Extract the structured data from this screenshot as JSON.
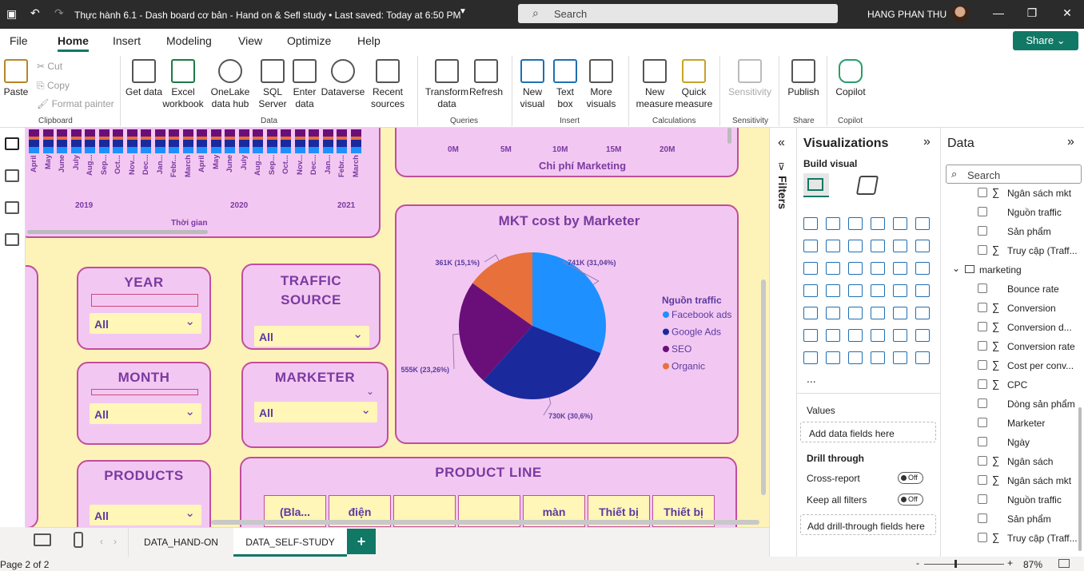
{
  "titlebar": {
    "title": "Thực hành 6.1 - Dash board cơ bản - Hand on & Sefl study • Last saved: Today at 6:50 PM",
    "search_placeholder": "Search",
    "user": "HANG PHAN THU"
  },
  "menu": {
    "file": "File",
    "home": "Home",
    "insert": "Insert",
    "modeling": "Modeling",
    "view": "View",
    "optimize": "Optimize",
    "help": "Help",
    "share": "Share"
  },
  "ribbon": {
    "paste": "Paste",
    "cut": "Cut",
    "copy": "Copy",
    "format_painter": "Format painter",
    "clipboard": "Clipboard",
    "get_data": "Get data",
    "excel": "Excel workbook",
    "onelake": "OneLake data hub",
    "sql": "SQL Server",
    "enter": "Enter data",
    "dataverse": "Dataverse",
    "recent": "Recent sources",
    "data_group": "Data",
    "transform": "Transform data",
    "refresh": "Refresh",
    "queries": "Queries",
    "new_visual": "New visual",
    "text_box": "Text box",
    "more_visuals": "More visuals",
    "insert_group": "Insert",
    "new_measure": "New measure",
    "quick_measure": "Quick measure",
    "calculations": "Calculations",
    "sensitivity": "Sensitivity",
    "sensitivity_group": "Sensitivity",
    "publish": "Publish",
    "share_group": "Share",
    "copilot": "Copilot",
    "copilot_group": "Copilot"
  },
  "canvas": {
    "years": [
      "2019",
      "2020",
      "2021"
    ],
    "months": [
      "April",
      "May",
      "June",
      "July",
      "Aug...",
      "Sep...",
      "Oct...",
      "Nov...",
      "Dec...",
      "Jan...",
      "Febr...",
      "March",
      "April",
      "May",
      "June",
      "July",
      "Aug...",
      "Sep...",
      "Oct...",
      "Nov...",
      "Dec...",
      "Jan...",
      "Febr...",
      "March"
    ],
    "time_axis": "Thời gian",
    "bar_ticks": [
      "0M",
      "5M",
      "10M",
      "15M",
      "20M"
    ],
    "bar_axis_title": "Chi phí Marketing",
    "slicers": {
      "year": {
        "title": "YEAR",
        "value": "All"
      },
      "traffic": {
        "title": "TRAFFIC SOURCE",
        "value": "All"
      },
      "month": {
        "title": "MONTH",
        "value": "All"
      },
      "marketer": {
        "title": "MARKETER",
        "value": "All"
      },
      "products": {
        "title": "PRODUCTS",
        "value": "All"
      }
    },
    "product_line": {
      "title": "PRODUCT LINE",
      "headers": [
        "(Bla...",
        "điện",
        "",
        "",
        "màn",
        "Thiết bị",
        "Thiết bị"
      ]
    }
  },
  "chart_data": {
    "type": "pie",
    "title": "MKT cost by Marketer",
    "legend_title": "Nguồn traffic",
    "legend_position": "right",
    "categories": [
      "Facebook ads",
      "Google Ads",
      "SEO",
      "Organic"
    ],
    "values": [
      741,
      730,
      555,
      361
    ],
    "percent": [
      31.04,
      30.6,
      23.26,
      15.1
    ],
    "labels": [
      "741K (31,04%)",
      "730K (30,6%)",
      "555K (23,26%)",
      "361K (15,1%)"
    ],
    "colors": [
      "#1e90ff",
      "#1a2a9c",
      "#6a0f7a",
      "#e8703a"
    ]
  },
  "tabs": {
    "tab1": "DATA_HAND-ON",
    "tab2": "DATA_SELF-STUDY",
    "add": "+"
  },
  "status": {
    "page": "Page 2 of 2",
    "zoom": "87%",
    "minus": "-",
    "plus": "+"
  },
  "filters": {
    "label": "Filters"
  },
  "visualizations": {
    "title": "Visualizations",
    "build": "Build visual",
    "values": "Values",
    "add_fields": "Add data fields here",
    "drill": "Drill through",
    "cross": "Cross-report",
    "cross_state": "Off",
    "keep": "Keep all filters",
    "keep_state": "Off",
    "add_drill": "Add drill-through fields here",
    "more": "..."
  },
  "data": {
    "title": "Data",
    "search": "Search",
    "fields_top": [
      {
        "sigma": "∑",
        "name": "Ngân sách mkt"
      },
      {
        "sigma": "",
        "name": "Nguồn traffic"
      },
      {
        "sigma": "",
        "name": "Sản phẩm"
      },
      {
        "sigma": "∑",
        "name": "Truy cập (Traff..."
      }
    ],
    "table": "marketing",
    "fields": [
      {
        "sigma": "",
        "name": "Bounce rate"
      },
      {
        "sigma": "∑",
        "name": "Conversion"
      },
      {
        "sigma": "∑",
        "name": "Conversion d..."
      },
      {
        "sigma": "∑",
        "name": "Conversion rate"
      },
      {
        "sigma": "∑",
        "name": "Cost per conv..."
      },
      {
        "sigma": "∑",
        "name": "CPC"
      },
      {
        "sigma": "",
        "name": "Dòng sản phẩm"
      },
      {
        "sigma": "",
        "name": "Marketer"
      },
      {
        "sigma": "",
        "name": "Ngày"
      },
      {
        "sigma": "∑",
        "name": "Ngân sách"
      },
      {
        "sigma": "∑",
        "name": "Ngân sách mkt"
      },
      {
        "sigma": "",
        "name": "Nguồn traffic"
      },
      {
        "sigma": "",
        "name": "Sản phẩm"
      },
      {
        "sigma": "∑",
        "name": "Truy cập (Traff..."
      }
    ]
  }
}
